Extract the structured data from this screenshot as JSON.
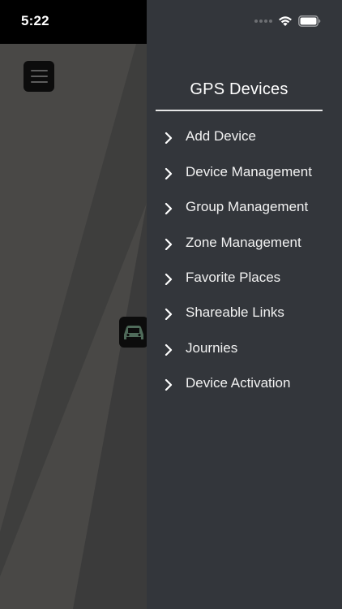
{
  "status_bar": {
    "time": "5:22"
  },
  "icons": {
    "menu": "hamburger-menu-icon",
    "vehicle": "car-icon",
    "wifi": "wifi-icon",
    "battery": "battery-icon",
    "chevron": "chevron-right-icon"
  },
  "drawer": {
    "title": "GPS Devices",
    "items": [
      {
        "label": "Add Device"
      },
      {
        "label": "Device Management"
      },
      {
        "label": "Group Management"
      },
      {
        "label": "Zone Management"
      },
      {
        "label": "Favorite Places"
      },
      {
        "label": "Shareable Links"
      },
      {
        "label": "Journies"
      },
      {
        "label": "Device Activation"
      }
    ]
  },
  "colors": {
    "drawer_bg": "#33363b",
    "map_bg": "#494846",
    "map_road": "#3a3a3a",
    "car_icon": "#4f6b5a"
  }
}
